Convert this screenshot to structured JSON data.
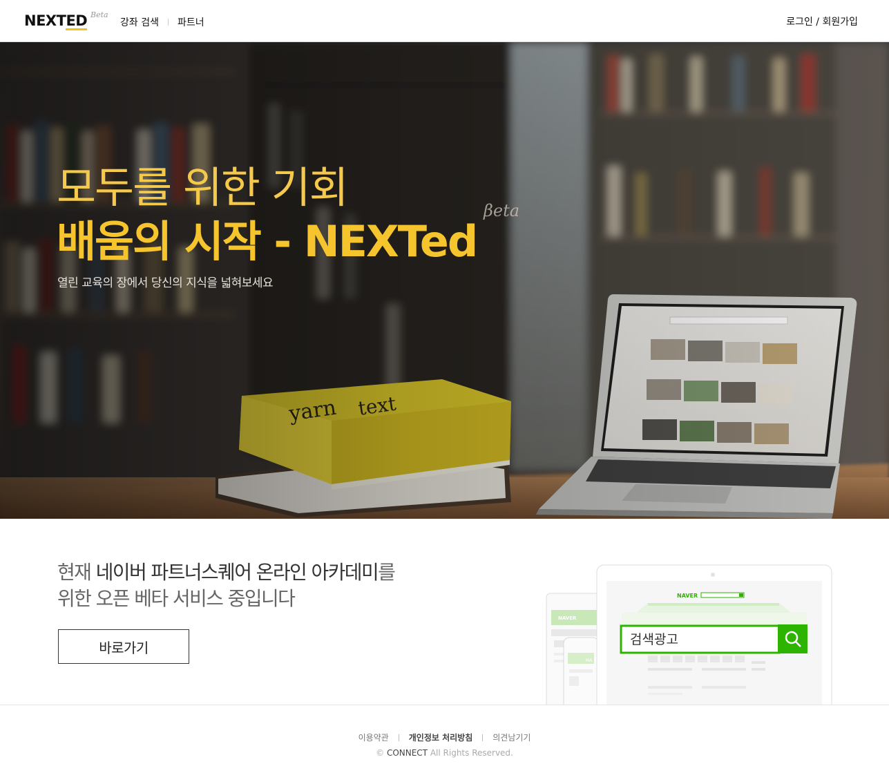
{
  "header": {
    "logo_main": "NEXT",
    "logo_ed": "ED",
    "logo_beta": "Beta",
    "nav": [
      "강좌 검색",
      "파트너"
    ],
    "login_label": "로그인 / 회원가입"
  },
  "hero": {
    "title_line1": "모두를 위한 기회",
    "title_line2": "배움의 시작 - NEXTed",
    "beta": "βeta",
    "subtitle": "열린 교육의 장에서 당신의 지식을 넓혀보세요",
    "title_color": "#f6c52e"
  },
  "promo": {
    "prefix": "현재",
    "highlight": "네이버 파트너스퀘어 온라인 아카데미",
    "suffix": "를",
    "line2": "위한 오픈 베타 서비스 중입니다",
    "button_label": "바로가기",
    "device_brand": "NAVER",
    "search_text": "검색광고",
    "accent_color": "#2db400"
  },
  "footer": {
    "links": [
      "이용약관",
      "개인정보 처리방침",
      "의견남기기"
    ],
    "copyright_symbol": "©",
    "copyright_brand": "CONNECT",
    "copyright_rest": "All Rights Reserved."
  }
}
